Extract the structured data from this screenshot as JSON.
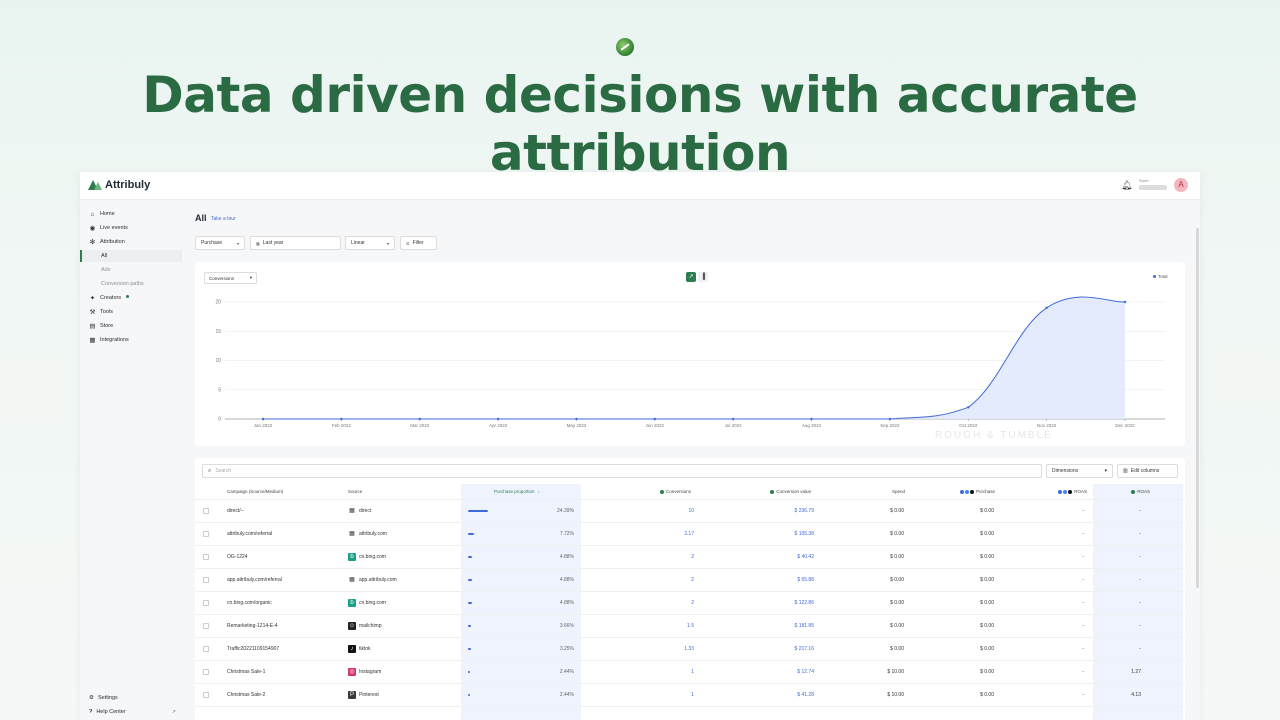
{
  "headline": "Data driven decisions with accurate attribution",
  "app": {
    "brand": "Attribuly",
    "store_label": "Store",
    "avatar_letter": "A"
  },
  "sidebar": {
    "items": [
      {
        "label": "Home",
        "icon": "home-icon"
      },
      {
        "label": "Live events",
        "icon": "live-icon"
      },
      {
        "label": "Attribution",
        "icon": "attribution-icon"
      }
    ],
    "sub_items": [
      "All",
      "Ads",
      "Conversion paths"
    ],
    "items2": [
      {
        "label": "Creators",
        "icon": "creators-icon"
      },
      {
        "label": "Tools",
        "icon": "tools-icon"
      },
      {
        "label": "Store",
        "icon": "store-icon"
      },
      {
        "label": "Integrations",
        "icon": "integrations-icon"
      }
    ],
    "bottom": [
      {
        "label": "Settings",
        "icon": "gear-icon"
      },
      {
        "label": "Help Center",
        "icon": "help-icon"
      }
    ]
  },
  "page": {
    "title": "All",
    "tour": "Take a tour",
    "filters": {
      "event": "Purchase",
      "date": "Last year",
      "model": "Linear",
      "filter": "Filter"
    }
  },
  "chart_panel": {
    "metric": "Conversions",
    "legend": "Total",
    "watermark": "ROUGH & TUMBLE"
  },
  "chart_data": {
    "type": "area",
    "series": [
      {
        "name": "Total",
        "values": [
          0,
          0,
          0,
          0,
          0,
          0,
          0,
          0,
          0,
          2,
          19,
          20
        ]
      }
    ],
    "categories": [
      "Jan 2022",
      "Feb 2022",
      "Mar 2022",
      "Apr 2022",
      "May 2022",
      "Jun 2022",
      "Jul 2022",
      "Aug 2022",
      "Sep 2022",
      "Oct 2022",
      "Nov 2022",
      "Dec 2022"
    ],
    "yticks": [
      "0",
      "5",
      "10",
      "15",
      "20"
    ],
    "ylim": [
      0,
      20
    ],
    "grid": true,
    "legend": "top-right",
    "color": "#3f6ad8"
  },
  "table": {
    "search_placeholder": "Search",
    "dimensions_label": "Dimensions",
    "edit_columns_label": "Edit columns",
    "headers": {
      "campaign": "Campaign (Source/Medium)",
      "source": "Source",
      "proportion": "Purchase proportion",
      "conversions": "Conversions",
      "value": "Conversion value",
      "spend": "Spend",
      "purchase": "Purchase",
      "roas1": "ROAS",
      "roas2": "ROAS"
    },
    "rows": [
      {
        "campaign": "direct/--",
        "source": "direct",
        "src_icon": "grid-icon",
        "proportion": "24.39%",
        "pct": 0.2439,
        "conversions": "10",
        "value": "$ 236.79",
        "spend": "$ 0.00",
        "purchase": "$ 0.00",
        "roas1": "-",
        "roas2": "-"
      },
      {
        "campaign": "attribuly.com/referral",
        "source": "attribuly.com",
        "src_icon": "grid-icon",
        "proportion": "7.72%",
        "pct": 0.0772,
        "conversions": "3.17",
        "value": "$ 105.38",
        "spend": "$ 0.00",
        "purchase": "$ 0.00",
        "roas1": "-",
        "roas2": "-"
      },
      {
        "campaign": "OG-1224",
        "source": "cn.bing.com",
        "src_icon": "bing-icon",
        "proportion": "4.88%",
        "pct": 0.0488,
        "conversions": "2",
        "value": "$ 40.42",
        "spend": "$ 0.00",
        "purchase": "$ 0.00",
        "roas1": "-",
        "roas2": "-"
      },
      {
        "campaign": "app.attribuly.com/referral",
        "source": "app.attribuly.com",
        "src_icon": "grid-icon",
        "proportion": "4.88%",
        "pct": 0.0488,
        "conversions": "2",
        "value": "$ 65.88",
        "spend": "$ 0.00",
        "purchase": "$ 0.00",
        "roas1": "-",
        "roas2": "-"
      },
      {
        "campaign": "cn.bing.com/organic",
        "source": "cn.bing.com",
        "src_icon": "bing-icon",
        "proportion": "4.88%",
        "pct": 0.0488,
        "conversions": "2",
        "value": "$ 122.86",
        "spend": "$ 0.00",
        "purchase": "$ 0.00",
        "roas1": "-",
        "roas2": "-"
      },
      {
        "campaign": "Remarketing-1214-E-4",
        "source": "mailchimp",
        "src_icon": "mailchimp-icon",
        "proportion": "3.66%",
        "pct": 0.0366,
        "conversions": "1.5",
        "value": "$ 181.85",
        "spend": "$ 0.00",
        "purchase": "$ 0.00",
        "roas1": "-",
        "roas2": "-"
      },
      {
        "campaign": "Traffic20221109154907",
        "source": "tiktok",
        "src_icon": "tiktok-icon",
        "proportion": "3.25%",
        "pct": 0.0325,
        "conversions": "1.33",
        "value": "$ 217.16",
        "spend": "$ 0.00",
        "purchase": "$ 0.00",
        "roas1": "-",
        "roas2": "-"
      },
      {
        "campaign": "Christmas Sale-1",
        "source": "Instagram",
        "src_icon": "instagram-icon",
        "proportion": "2.44%",
        "pct": 0.0244,
        "conversions": "1",
        "value": "$ 12.74",
        "spend": "$ 10.00",
        "purchase": "$ 0.00",
        "roas1": "-",
        "roas2": "1.27"
      },
      {
        "campaign": "Christmas Sale-2",
        "source": "Pinterest",
        "src_icon": "pinterest-icon",
        "proportion": "2.44%",
        "pct": 0.0244,
        "conversions": "1",
        "value": "$ 41.28",
        "spend": "$ 10.00",
        "purchase": "$ 0.00",
        "roas1": "-",
        "roas2": "4.13"
      }
    ]
  }
}
